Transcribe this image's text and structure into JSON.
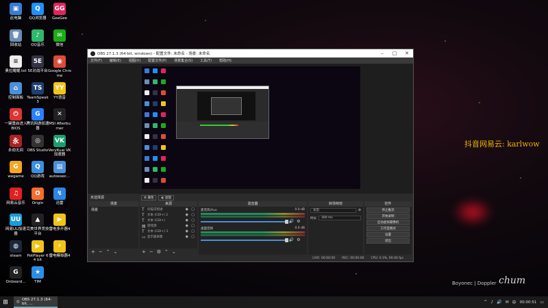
{
  "desktop_icons": [
    {
      "label": "此电脑",
      "color": "#3a7bd5",
      "glyph": "▣",
      "icon": "computer-icon"
    },
    {
      "label": "QQ浏览器",
      "color": "#1e90ff",
      "glyph": "Q",
      "icon": "qq-browser-icon"
    },
    {
      "label": "GeeGee",
      "color": "#e0245e",
      "glyph": "GG",
      "icon": "geegee-icon"
    },
    {
      "label": "回收站",
      "color": "#6b8fb5",
      "glyph": "🗑",
      "icon": "recycle-bin-icon"
    },
    {
      "label": "QQ音乐",
      "color": "#2fb86b",
      "glyph": "♪",
      "icon": "qq-music-icon"
    },
    {
      "label": "微信",
      "color": "#1aad19",
      "glyph": "✉",
      "icon": "wechat-icon"
    },
    {
      "label": "奥拉耀耀.txt",
      "color": "#eeeeee",
      "glyph": "≡",
      "icon": "text-file-icon"
    },
    {
      "label": "5E对战平台",
      "color": "#334",
      "glyph": "5E",
      "icon": "5e-platform-icon"
    },
    {
      "label": "Google Chrome",
      "color": "#dd4b39",
      "glyph": "◉",
      "icon": "chrome-icon"
    },
    {
      "label": "控制面板",
      "color": "#4a90d9",
      "glyph": "⌂",
      "icon": "control-panel-icon"
    },
    {
      "label": "TeamSpeak 3",
      "color": "#1d3f72",
      "glyph": "TS",
      "icon": "teamspeak-icon"
    },
    {
      "label": "YY语音",
      "color": "#f0c419",
      "glyph": "YY",
      "icon": "yy-voice-icon"
    },
    {
      "label": "一键重启进入BIOS",
      "color": "#d33",
      "glyph": "⏻",
      "icon": "bios-icon"
    },
    {
      "label": "腾讯网游加速器",
      "color": "#2a7fff",
      "glyph": "G",
      "icon": "tencent-booster-icon"
    },
    {
      "label": "MSI Afterburner",
      "color": "#222",
      "glyph": "✕",
      "icon": "afterburner-icon"
    },
    {
      "label": "永劫无间",
      "color": "#a22",
      "glyph": "永",
      "icon": "naraka-icon"
    },
    {
      "label": "OBS Studio",
      "color": "#333",
      "glyph": "◎",
      "icon": "obs-icon"
    },
    {
      "label": "VeryKuai VK加速器",
      "color": "#1a9e6e",
      "glyph": "VK",
      "icon": "verykuai-icon"
    },
    {
      "label": "wegame",
      "color": "#f5a623",
      "glyph": "G",
      "icon": "wegame-icon"
    },
    {
      "label": "QQ游戏",
      "color": "#3b8fe0",
      "glyph": "Q",
      "icon": "qq-game-icon"
    },
    {
      "label": "autoexec...",
      "color": "#4a90d9",
      "glyph": "▤",
      "icon": "config-file-icon"
    },
    {
      "label": "网易云音乐",
      "color": "#e02020",
      "glyph": "♫",
      "icon": "netease-music-icon"
    },
    {
      "label": "Origin",
      "color": "#f56c2d",
      "glyph": "O",
      "icon": "origin-icon"
    },
    {
      "label": "迅雷",
      "color": "#2b86e8",
      "glyph": "↯",
      "icon": "xunlei-icon"
    },
    {
      "label": "网易UU加速器",
      "color": "#1c9bd6",
      "glyph": "UU",
      "icon": "uu-booster-icon"
    },
    {
      "label": "完美世界竞技平台",
      "color": "#222",
      "glyph": "▲",
      "icon": "perfect-world-icon"
    },
    {
      "label": "雷电多开器4",
      "color": "#f0c419",
      "glyph": "▶",
      "icon": "ldplayer-multi-icon"
    },
    {
      "label": "steam",
      "color": "#1b2838",
      "glyph": "◍",
      "icon": "steam-icon"
    },
    {
      "label": "PotPlayer 64 bit",
      "color": "#f0c419",
      "glyph": "▶",
      "icon": "potplayer-icon"
    },
    {
      "label": "雷电模拟器4",
      "color": "#f0c419",
      "glyph": "⚡",
      "icon": "ldplayer-icon"
    },
    {
      "label": "Onboard...",
      "color": "#222",
      "glyph": "G",
      "icon": "onboard-icon"
    },
    {
      "label": "TIM",
      "color": "#2a8ee8",
      "glyph": "★",
      "icon": "tim-icon"
    }
  ],
  "watermark_cn": "抖音网易云: karlwow",
  "watermark_sig": "Boyonec | Doppler",
  "watermark_hand": "chum",
  "obs": {
    "title": "OBS 27.1.3 (64-bit, windows) - 配置文件: 未命名 - 场景: 未命名",
    "menu": [
      "文件(F)",
      "编辑(E)",
      "视图(V)",
      "配置文件(P)",
      "场景集合(S)",
      "工具(T)",
      "帮助(H)"
    ],
    "scene_bar_label": "未选择源",
    "props_btn": "属性",
    "filters_btn": "滤镜",
    "docks": {
      "scenes": "场景",
      "sources": "来源",
      "mixer": "混音器",
      "transitions": "转场特效",
      "controls": "控件"
    },
    "scene_items": [
      "场景"
    ],
    "sources": [
      {
        "label": "扫描识别进",
        "icon": "T"
      },
      {
        "label": "文本 (GDI+) 2",
        "icon": "T"
      },
      {
        "label": "文本 (GDI+)",
        "icon": "T"
      },
      {
        "label": "游戏源",
        "icon": "▤"
      },
      {
        "label": "文本 (GDI+) 3",
        "icon": "T"
      },
      {
        "label": "显示器采集",
        "icon": "▭"
      }
    ],
    "mixer": [
      {
        "label": "麦克风/Aux",
        "db": "0.0 dB"
      },
      {
        "label": "桌面音频",
        "db": "0.0 dB"
      }
    ],
    "transition": {
      "type": "淡出",
      "duration_label": "时长",
      "duration": "300 ms"
    },
    "controls": [
      "停止推流",
      "开始录制",
      "启动虚拟摄像机",
      "工作室模式",
      "设置",
      "退出"
    ],
    "status": [
      "LIVE: 00:00:00",
      "REC: 00:00:00",
      "CPU: 0.3%, 60.00 fps"
    ]
  },
  "taskbar": {
    "task_label": "OBS 27.1.3 (64-bit, ...",
    "clock": "00:00:51",
    "tray_glyphs": [
      "^",
      "♪",
      "🔊",
      "✉",
      "中"
    ]
  }
}
